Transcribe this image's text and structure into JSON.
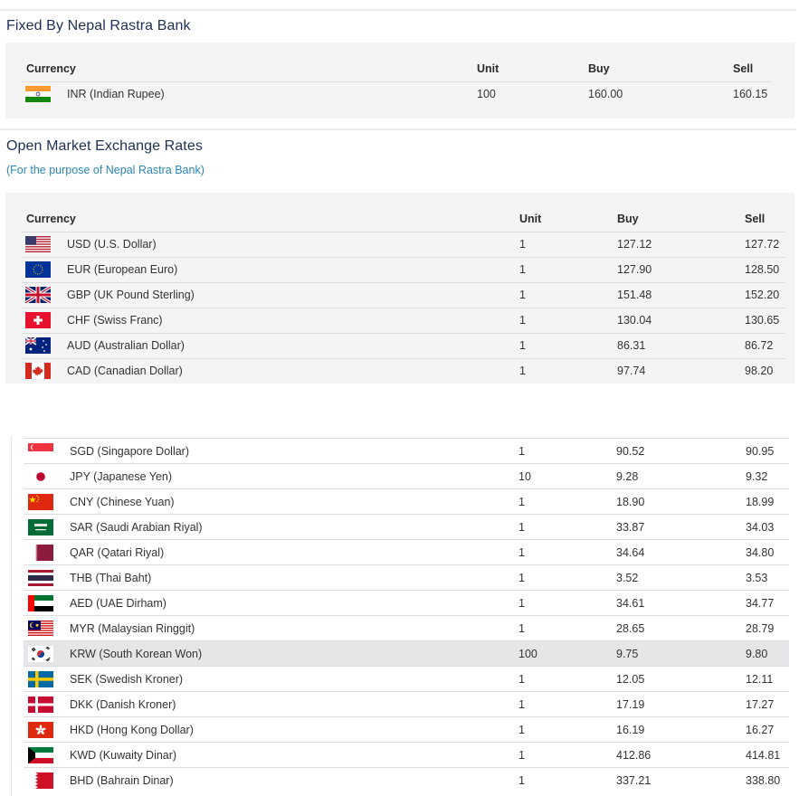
{
  "fixed": {
    "title": "Fixed By Nepal Rastra Bank",
    "headers": {
      "currency": "Currency",
      "unit": "Unit",
      "buy": "Buy",
      "sell": "Sell"
    },
    "rows": [
      {
        "flag": "india-flag-icon",
        "name": "INR (Indian Rupee)",
        "unit": "100",
        "buy": "160.00",
        "sell": "160.15"
      }
    ]
  },
  "open": {
    "title": "Open Market Exchange Rates",
    "subtitle": "(For the purpose of Nepal Rastra Bank)",
    "headers": {
      "currency": "Currency",
      "unit": "Unit",
      "buy": "Buy",
      "sell": "Sell"
    },
    "rows_top": [
      {
        "flag": "usa-flag-icon",
        "name": "USD (U.S. Dollar)",
        "unit": "1",
        "buy": "127.12",
        "sell": "127.72"
      },
      {
        "flag": "eu-flag-icon",
        "name": "EUR (European Euro)",
        "unit": "1",
        "buy": "127.90",
        "sell": "128.50"
      },
      {
        "flag": "uk-flag-icon",
        "name": "GBP (UK Pound Sterling)",
        "unit": "1",
        "buy": "151.48",
        "sell": "152.20"
      },
      {
        "flag": "swiss-flag-icon",
        "name": "CHF (Swiss Franc)",
        "unit": "1",
        "buy": "130.04",
        "sell": "130.65"
      },
      {
        "flag": "australia-flag-icon",
        "name": "AUD (Australian Dollar)",
        "unit": "1",
        "buy": "86.31",
        "sell": "86.72"
      },
      {
        "flag": "canada-flag-icon",
        "name": "CAD (Canadian Dollar)",
        "unit": "1",
        "buy": "97.74",
        "sell": "98.20"
      }
    ],
    "rows_bottom": [
      {
        "flag": "singapore-flag-icon",
        "name": "SGD (Singapore Dollar)",
        "unit": "1",
        "buy": "90.52",
        "sell": "90.95"
      },
      {
        "flag": "japan-flag-icon",
        "name": "JPY (Japanese Yen)",
        "unit": "10",
        "buy": "9.28",
        "sell": "9.32"
      },
      {
        "flag": "china-flag-icon",
        "name": "CNY (Chinese Yuan)",
        "unit": "1",
        "buy": "18.90",
        "sell": "18.99"
      },
      {
        "flag": "saudi-flag-icon",
        "name": "SAR (Saudi Arabian Riyal)",
        "unit": "1",
        "buy": "33.87",
        "sell": "34.03"
      },
      {
        "flag": "qatar-flag-icon",
        "name": "QAR (Qatari Riyal)",
        "unit": "1",
        "buy": "34.64",
        "sell": "34.80"
      },
      {
        "flag": "thailand-flag-icon",
        "name": "THB (Thai Baht)",
        "unit": "1",
        "buy": "3.52",
        "sell": "3.53"
      },
      {
        "flag": "uae-flag-icon",
        "name": "AED (UAE Dirham)",
        "unit": "1",
        "buy": "34.61",
        "sell": "34.77"
      },
      {
        "flag": "malaysia-flag-icon",
        "name": "MYR (Malaysian Ringgit)",
        "unit": "1",
        "buy": "28.65",
        "sell": "28.79"
      },
      {
        "flag": "korea-flag-icon",
        "name": "KRW (South Korean Won)",
        "unit": "100",
        "buy": "9.75",
        "sell": "9.80"
      },
      {
        "flag": "sweden-flag-icon",
        "name": "SEK (Swedish Kroner)",
        "unit": "1",
        "buy": "12.05",
        "sell": "12.11"
      },
      {
        "flag": "denmark-flag-icon",
        "name": "DKK (Danish Kroner)",
        "unit": "1",
        "buy": "17.19",
        "sell": "17.27"
      },
      {
        "flag": "hongkong-flag-icon",
        "name": "HKD (Hong Kong Dollar)",
        "unit": "1",
        "buy": "16.19",
        "sell": "16.27"
      },
      {
        "flag": "kuwait-flag-icon",
        "name": "KWD (Kuwaity Dinar)",
        "unit": "1",
        "buy": "412.86",
        "sell": "414.81"
      },
      {
        "flag": "bahrain-flag-icon",
        "name": "BHD (Bahrain Dinar)",
        "unit": "1",
        "buy": "337.21",
        "sell": "338.80"
      }
    ]
  }
}
